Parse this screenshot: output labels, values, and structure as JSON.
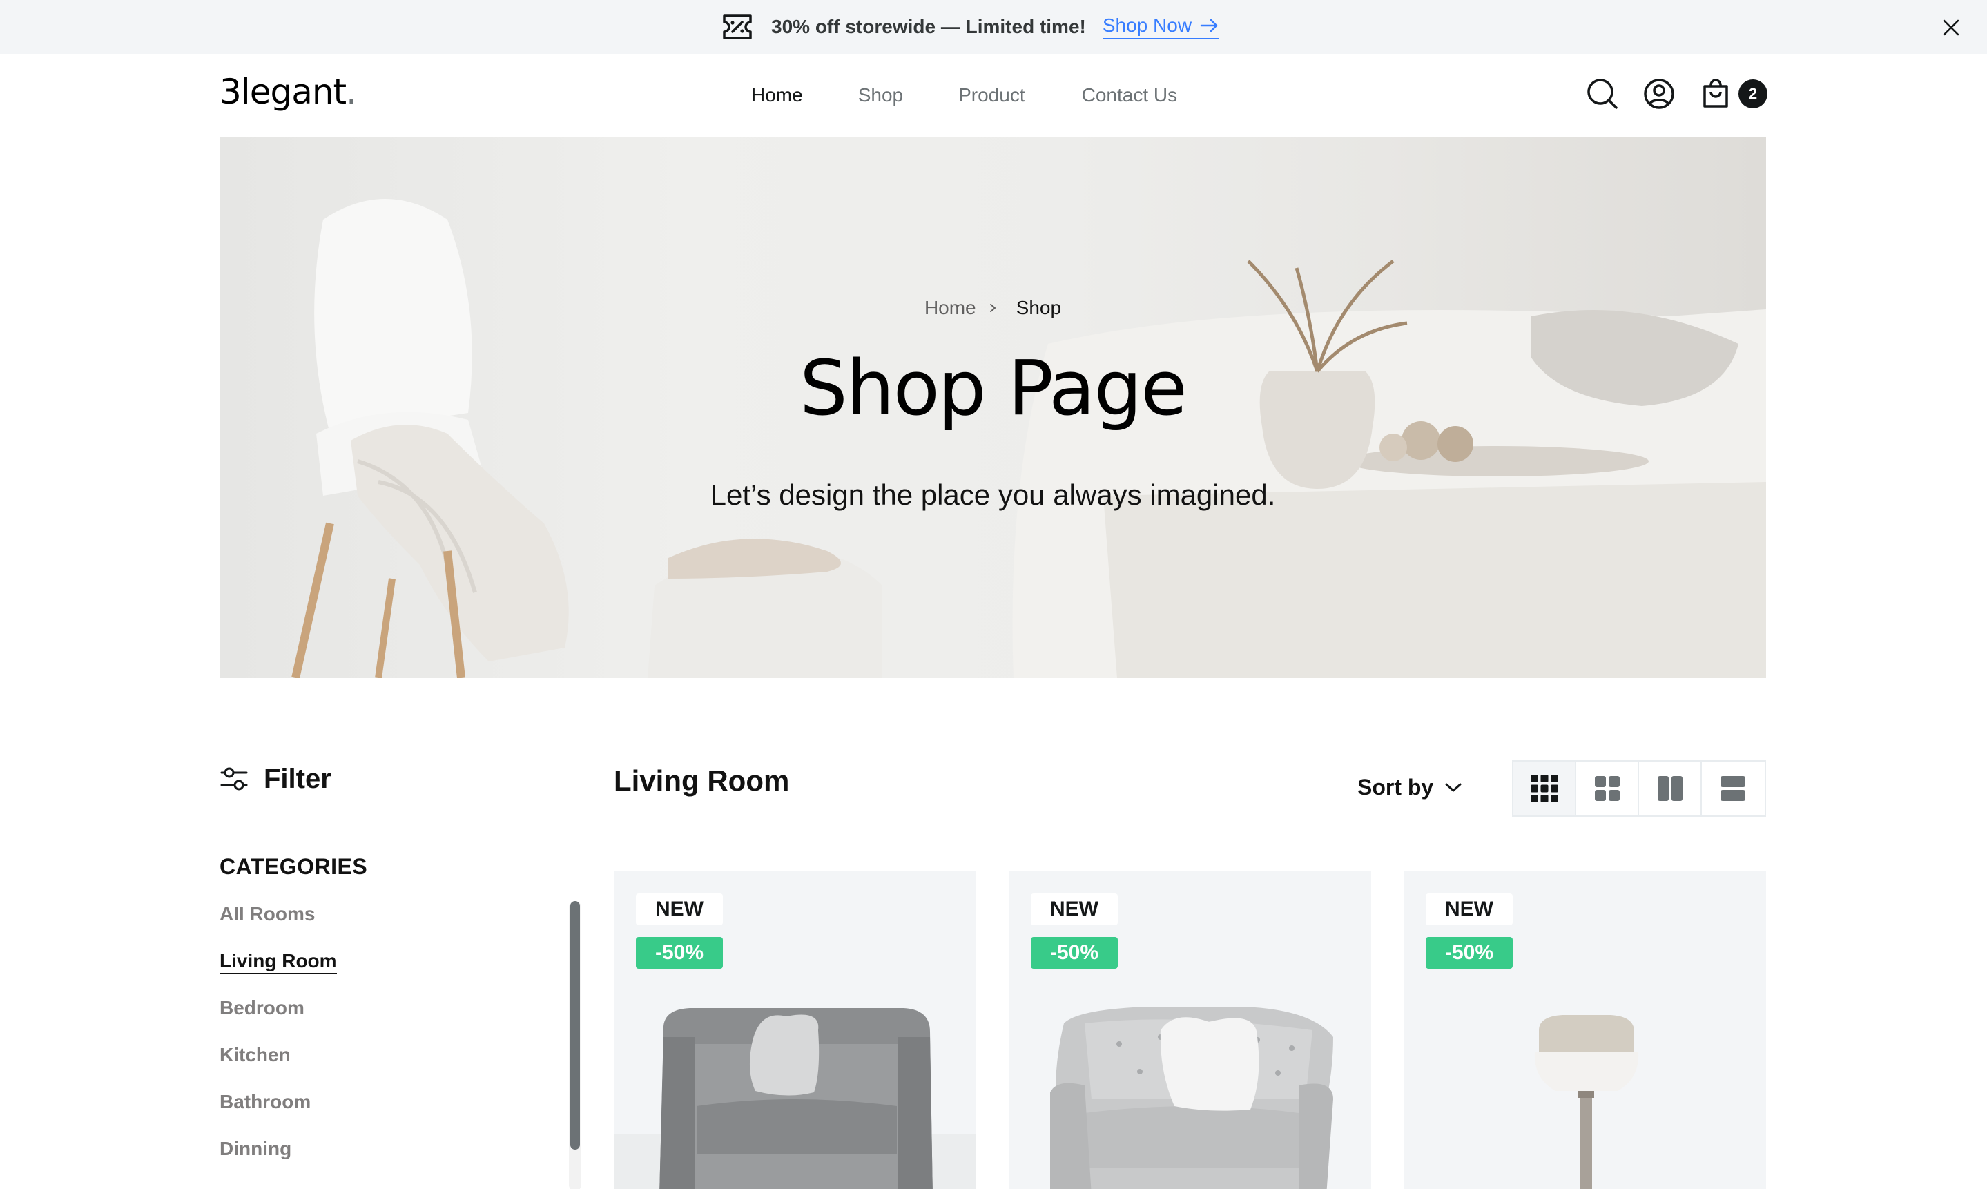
{
  "promo": {
    "text": "30% off storewide — Limited time!",
    "link_label": "Shop Now",
    "icon": "ticket-percent-icon"
  },
  "nav": {
    "logo_main": "3legant",
    "logo_dot": ".",
    "menu": [
      "Home",
      "Shop",
      "Product",
      "Contact Us"
    ],
    "active": "Home",
    "cart_count": "2"
  },
  "hero": {
    "breadcrumb_home": "Home",
    "breadcrumb_current": "Shop",
    "title": "Shop Page",
    "subtitle": "Let’s design the place you always imagined."
  },
  "filter": {
    "label": "Filter",
    "categories_title": "CATEGORIES",
    "categories": [
      "All Rooms",
      "Living Room",
      "Bedroom",
      "Kitchen",
      "Bathroom",
      "Dinning"
    ],
    "active_category": "Living Room"
  },
  "products": {
    "section_title": "Living Room",
    "sort_label": "Sort by",
    "items": [
      {
        "badge_new": "NEW",
        "badge_discount": "-50%",
        "image": "grey-armchair"
      },
      {
        "badge_new": "NEW",
        "badge_discount": "-50%",
        "image": "tufted-armchair"
      },
      {
        "badge_new": "NEW",
        "badge_discount": "-50%",
        "image": "table-lamp"
      }
    ]
  },
  "colors": {
    "accent_link": "#377dff",
    "discount_green": "#38cb89",
    "text_dark": "#141718",
    "text_muted": "#6c7275",
    "card_bg": "#f3f5f7"
  }
}
